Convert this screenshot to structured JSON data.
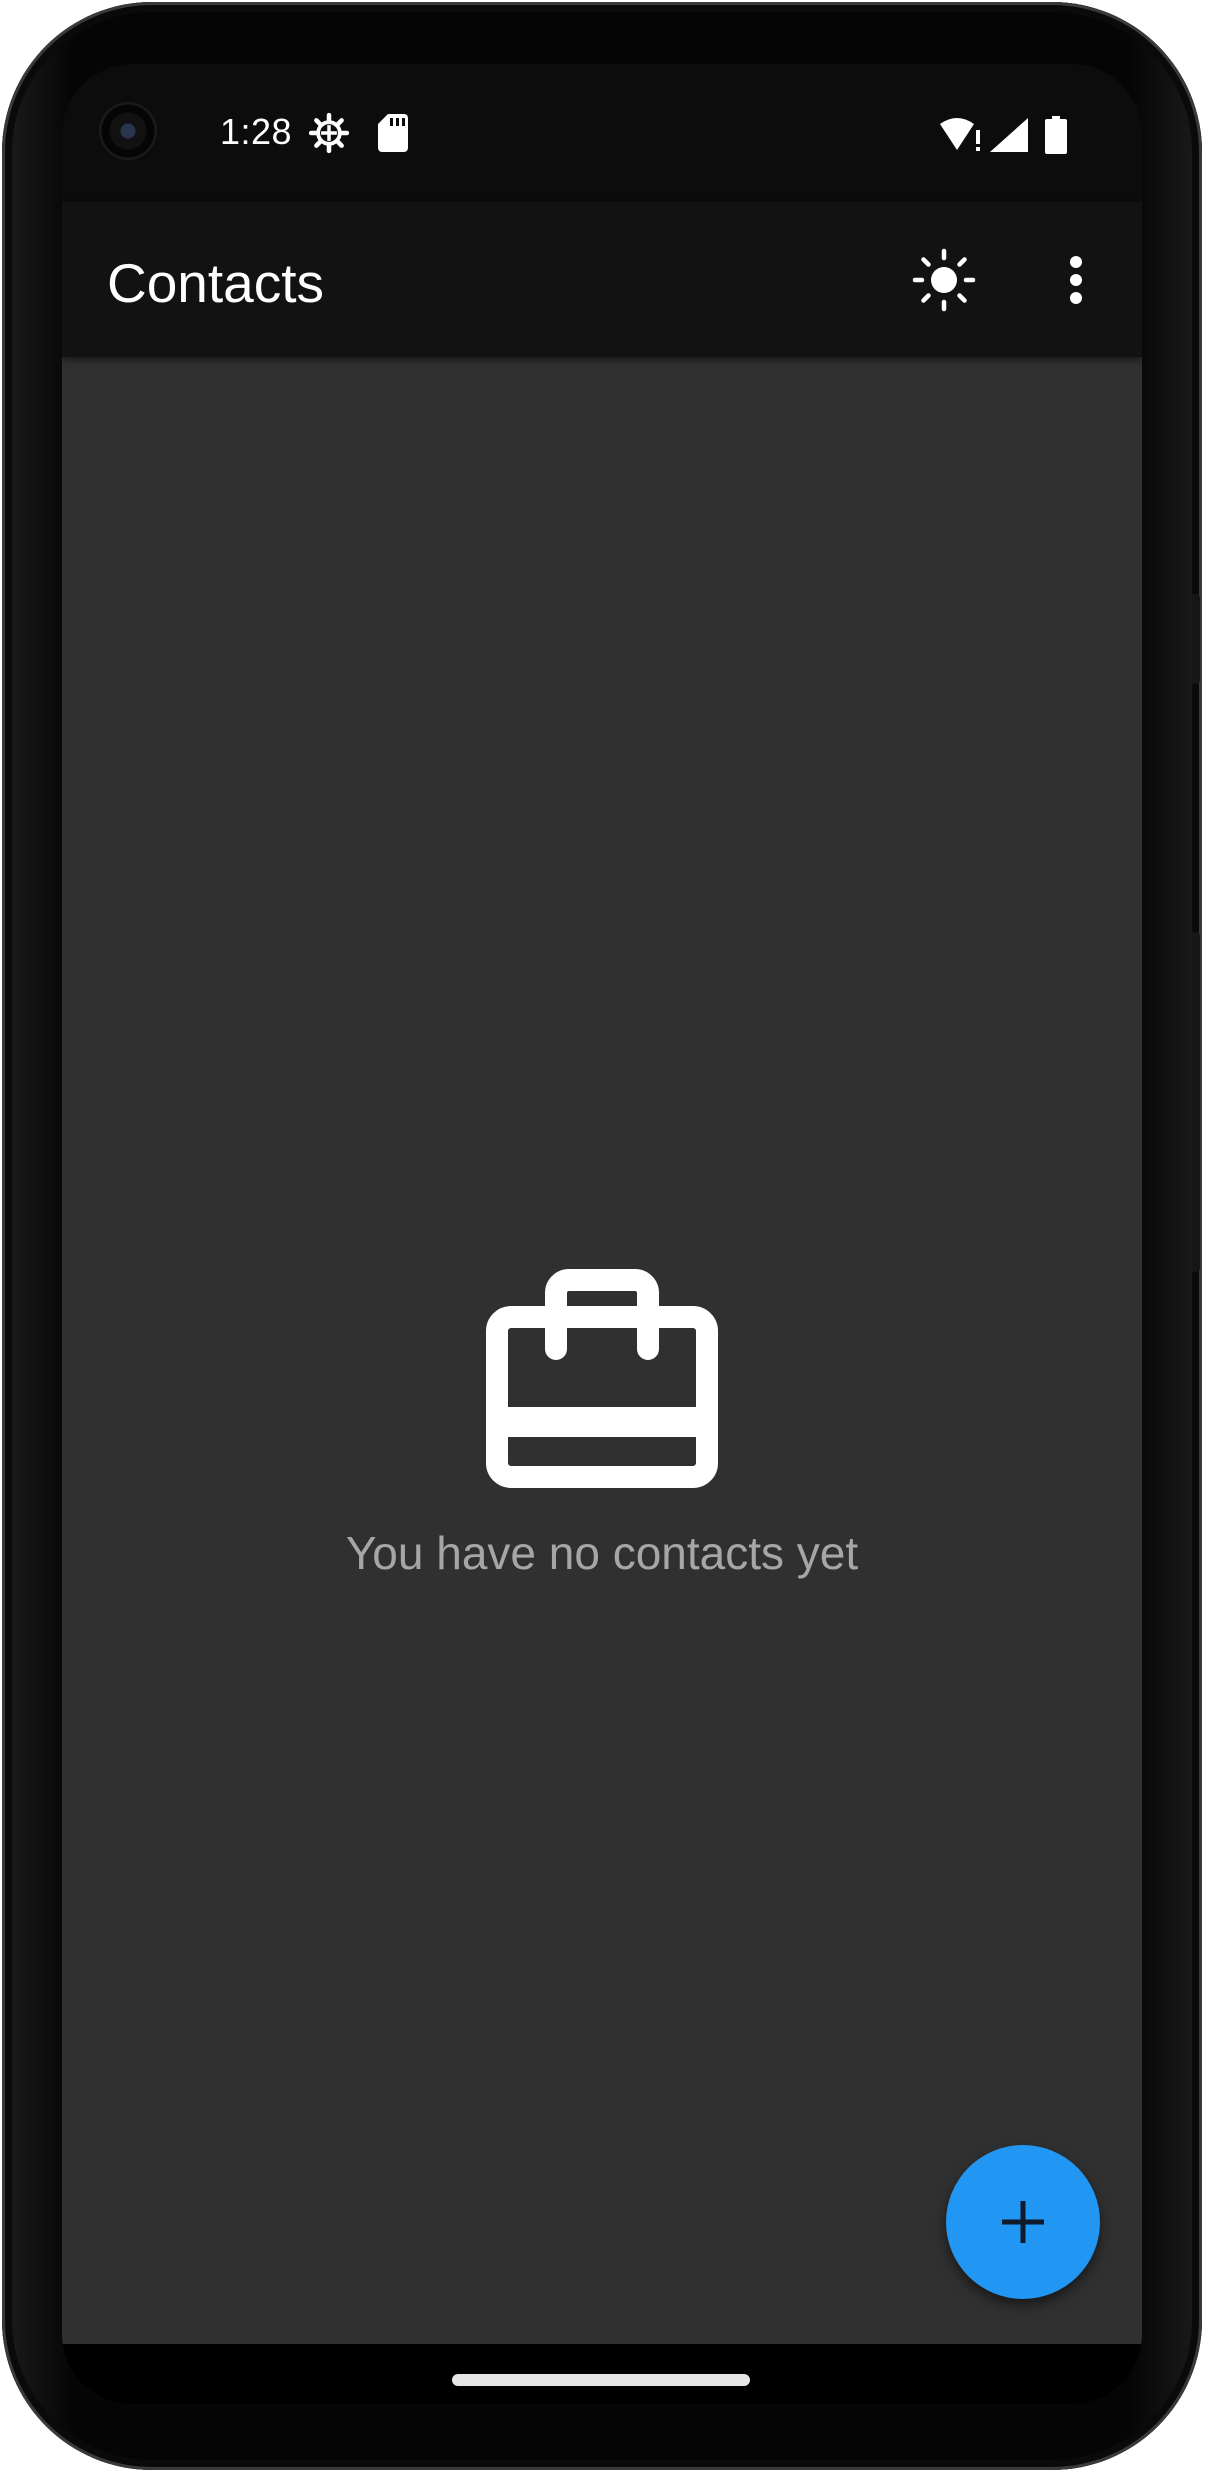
{
  "status_bar": {
    "time": "1:28",
    "left_icons": [
      "settings-gear-icon",
      "sd-card-icon"
    ],
    "right_icons": [
      "wifi-alert-icon",
      "cell-signal-icon",
      "battery-icon"
    ]
  },
  "app_bar": {
    "title": "Contacts",
    "actions": [
      "theme-toggle-sun-icon",
      "more-options-icon"
    ]
  },
  "empty_state": {
    "icon": "briefcase-icon",
    "message": "You have no contacts yet"
  },
  "fab": {
    "icon": "plus-icon",
    "color": "#2196f3"
  },
  "colors": {
    "app_bar_bg": "#121212",
    "content_bg": "#303030",
    "empty_text": "#a6a6a6",
    "accent": "#2196f3"
  }
}
